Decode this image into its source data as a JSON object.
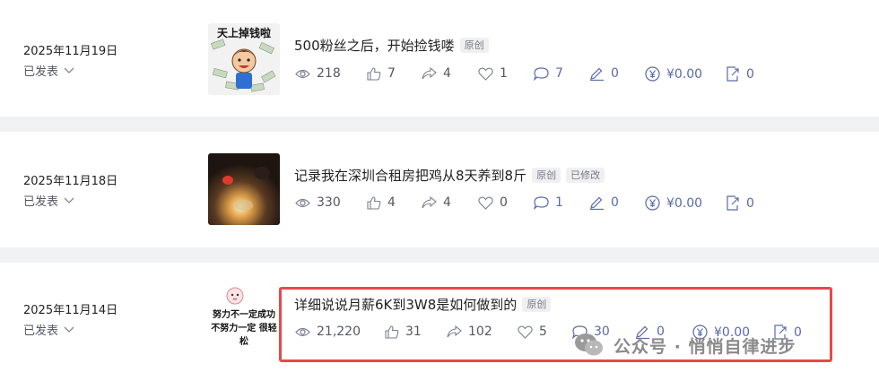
{
  "articles": [
    {
      "date": "2025年11月19日",
      "status": "已发表",
      "title": "500粉丝之后，开始捡钱喽",
      "tags": [
        "原创"
      ],
      "thumb_text": "天上掉钱啦",
      "stats": {
        "views": "218",
        "likes": "7",
        "shares": "4",
        "favorites": "1",
        "comments": "7",
        "edits": "0",
        "earnings": "¥0.00",
        "exports": "0"
      }
    },
    {
      "date": "2025年11月18日",
      "status": "已发表",
      "title": "记录我在深圳合租房把鸡从8天养到8斤",
      "tags": [
        "原创",
        "已修改"
      ],
      "stats": {
        "views": "330",
        "likes": "4",
        "shares": "4",
        "favorites": "0",
        "comments": "1",
        "edits": "0",
        "earnings": "¥0.00",
        "exports": "0"
      }
    },
    {
      "date": "2025年11月14日",
      "status": "已发表",
      "title": "详细说说月薪6K到3W8是如何做到的",
      "tags": [
        "原创"
      ],
      "thumb_text": "努力不一定成功 不努力一定 很轻松",
      "stats": {
        "views": "21,220",
        "likes": "31",
        "shares": "102",
        "favorites": "5",
        "comments": "30",
        "edits": "0",
        "earnings": "¥0.00",
        "exports": "0"
      }
    }
  ],
  "watermark": "公众号 · 悄悄自律进步",
  "colors": {
    "highlight": "#e8484c",
    "icon": "#5a6aa8",
    "text": "#555666"
  }
}
